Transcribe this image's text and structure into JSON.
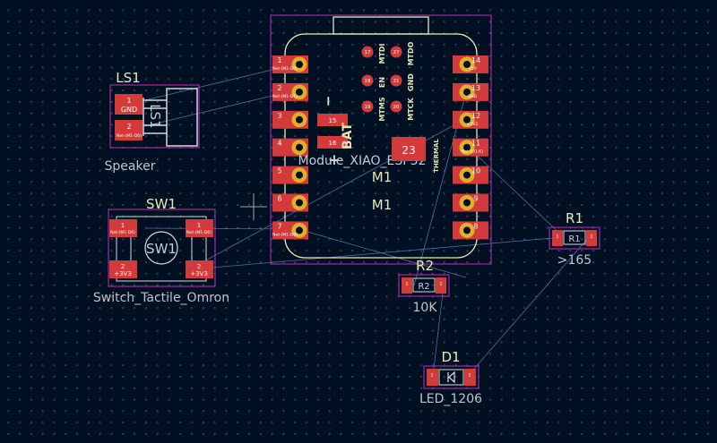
{
  "colors": {
    "background": "#001023",
    "courtyard": "#c22dc2",
    "pad": "#d43a3a",
    "pad_ring": "#e0ae2a",
    "silkscreen": "#eeeeee",
    "ratsnest": "#4a6fa0"
  },
  "footprints": {
    "ls1": {
      "reference": "LS1",
      "value": "Speaker",
      "body_label": "LS1",
      "pads": [
        {
          "num": "1",
          "net": "GND"
        },
        {
          "num": "2",
          "net": "Net-(M1-D6)"
        }
      ]
    },
    "sw1": {
      "reference": "SW1",
      "value": "Switch_Tactile_Omron",
      "body_label": "SW1",
      "pads": [
        {
          "num": "1",
          "net": "Net-(M1-D6)"
        },
        {
          "num": "1",
          "net": "Net-(M1-D6)"
        },
        {
          "num": "2",
          "net": "+3V3"
        },
        {
          "num": "2",
          "net": "+3V3"
        }
      ]
    },
    "m1": {
      "reference": "M1",
      "value": "M1",
      "fab_text": "Module_XIAO_ESP32",
      "bat_label": "BAT",
      "plus": "+",
      "minus": "−",
      "thermal_pad": "23",
      "thermal_label": "THERMAL",
      "small_pads": [
        "15",
        "16"
      ],
      "left_pins": [
        {
          "num": "1",
          "net": "Net-(M1-D0)"
        },
        {
          "num": "2",
          "net": "Net-(M1-D1)"
        },
        {
          "num": "3",
          "net": ""
        },
        {
          "num": "4",
          "net": ""
        },
        {
          "num": "5",
          "net": ""
        },
        {
          "num": "6",
          "net": ""
        },
        {
          "num": "7",
          "net": "Net-(M1-D6)"
        }
      ],
      "right_pins": [
        {
          "num": "14",
          "net": "+5V"
        },
        {
          "num": "13",
          "net": "GND"
        },
        {
          "num": "12",
          "net": "+3V3"
        },
        {
          "num": "11",
          "net": "Net-(D1-K)"
        },
        {
          "num": "10",
          "net": ""
        },
        {
          "num": "9",
          "net": ""
        },
        {
          "num": "8",
          "net": ""
        }
      ],
      "jtag_pads": [
        "17",
        "18",
        "19",
        "21",
        "20",
        "27"
      ],
      "jtag_labels": [
        "MTDI",
        "EN",
        "MTMS",
        "GND",
        "MTCK",
        "MTDO"
      ]
    },
    "r1": {
      "reference": "R1",
      "value": ">165",
      "body_label": "R1",
      "pads": [
        {
          "num": "1",
          "net": "Net-(D1-K)"
        },
        {
          "num": "2",
          "net": "+3V3"
        }
      ]
    },
    "r2": {
      "reference": "R2",
      "value": "10K",
      "body_label": "R2",
      "pads": [
        {
          "num": "1",
          "net": "GND"
        },
        {
          "num": "2",
          "net": "Net-(M1-D6)"
        }
      ]
    },
    "d1": {
      "reference": "D1",
      "value": "LED_1206",
      "pads": [
        {
          "num": "1",
          "net": "Net-(D1-K)"
        },
        {
          "num": "2",
          "net": "+3V3"
        }
      ]
    }
  }
}
